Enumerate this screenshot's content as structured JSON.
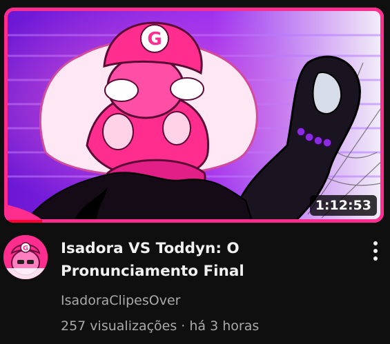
{
  "video": {
    "title_line1": "Isadora VS Toddyn: O",
    "title_line2": "Pronunciamento Final",
    "duration": "1:12:53",
    "channel": "IsadoraClipesOver",
    "views": "257 visualizações",
    "separator": "·",
    "age": "há 3 horas",
    "watched_fraction": 0.1,
    "thumbnail_letter": "G"
  },
  "avatar": {
    "letter": "G"
  },
  "icons": {
    "menu": "more-vert-icon"
  },
  "colors": {
    "background": "#0f0f0f",
    "title_text": "#f1f1f1",
    "secondary_text": "#aaaaaa",
    "progress": "#ff0033",
    "thumbnail_pink": "#ff2d8e",
    "thumbnail_purple": "#7a1fd6"
  }
}
